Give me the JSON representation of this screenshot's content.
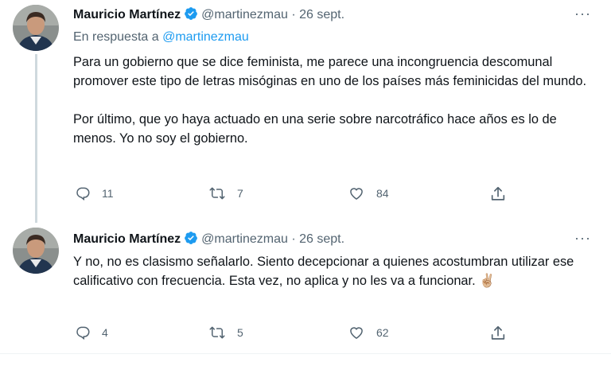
{
  "tweets": [
    {
      "author_name": "Mauricio Martínez",
      "handle": "@martinezmau",
      "separator": "·",
      "date": "26 sept.",
      "more": "···",
      "reply_prefix": "En respuesta a",
      "reply_handle": "@martinezmau",
      "paragraphs": [
        "Para un gobierno que se dice feminista, me parece una incongruencia descomunal promover este tipo de letras misóginas en uno de los países más feminicidas del mundo.",
        "Por último, que yo haya actuado en una serie sobre narcotráfico hace años es lo de menos. Yo no soy el gobierno."
      ],
      "replies": "11",
      "retweets": "7",
      "likes": "84"
    },
    {
      "author_name": "Mauricio Martínez",
      "handle": "@martinezmau",
      "separator": "·",
      "date": "26 sept.",
      "more": "···",
      "paragraphs": [
        "Y no, no es clasismo señalarlo. Siento decepcionar a quienes acostumbran utilizar ese calificativo con frecuencia. Esta vez, no aplica y no les va a funcionar. ✌🏼"
      ],
      "replies": "4",
      "retweets": "5",
      "likes": "62"
    }
  ],
  "colors": {
    "text": "#0f1419",
    "secondary": "#536471",
    "link": "#1d9bf0",
    "verified": "#1d9bf0",
    "thread_line": "#cfd9de"
  },
  "icons": [
    "verified-badge-icon",
    "more-icon",
    "reply-icon",
    "retweet-icon",
    "like-icon",
    "share-icon",
    "avatar"
  ]
}
